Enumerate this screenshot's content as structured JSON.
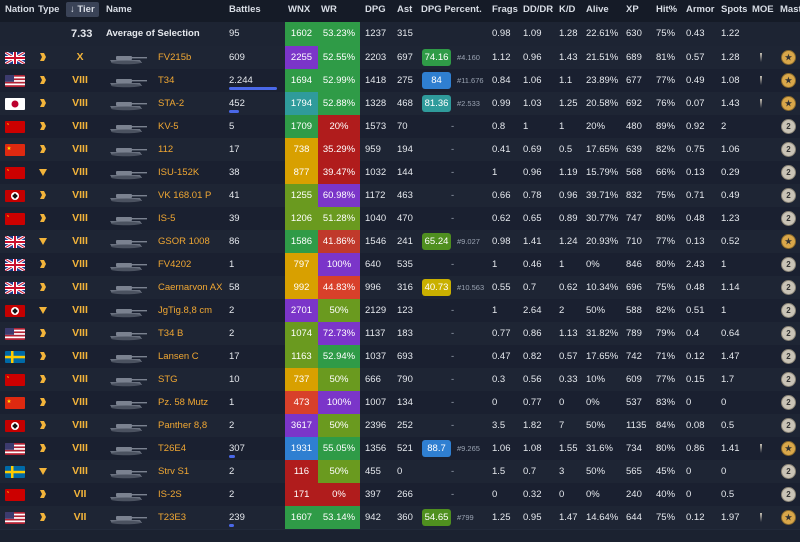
{
  "headers": {
    "nation": "Nation",
    "type": "Type",
    "tier": "↓ Tier",
    "name": "Name",
    "battles": "Battles",
    "wnx": "WNX",
    "wr": "WR",
    "dpg": "DPG",
    "ast": "Ast",
    "dpg_percent": "DPG Percent.",
    "frags": "Frags",
    "dddr": "DD/DR",
    "kd": "K/D",
    "alive": "Alive",
    "xp": "XP",
    "hit": "Hit%",
    "armor": "Armor",
    "spots": "Spots",
    "moe": "MOE",
    "mast": "Mast"
  },
  "average": {
    "tier": "7.33",
    "name": "Average of Selection",
    "battles": "95",
    "wnx": "1602",
    "wr": "53.23%",
    "dpg": "1237",
    "ast": "315",
    "frags": "0.98",
    "dddr": "1.09",
    "kd": "1.28",
    "alive": "22.61%",
    "xp": "630",
    "hit": "75%",
    "armor": "0.43",
    "spots": "1.22",
    "wnx_color": "#2f9b47",
    "wr_color": "#2f9b47"
  },
  "rows": [
    {
      "nation": "uk",
      "type": "td",
      "tier": "X",
      "name": "FV215b",
      "battles": "609",
      "bar": 0,
      "wnx": "2255",
      "wnx_color": "#7b35c9",
      "wr": "52.55%",
      "wr_color": "#2f9b47",
      "dpg": "2203",
      "ast": "697",
      "dpgp": "74.16",
      "dpgp_color": "#2f9b47",
      "rank": "#4.160",
      "frags": "1.12",
      "dddr": "0.96",
      "kd": "1.43",
      "alive": "21.51%",
      "xp": "689",
      "hit": "81%",
      "armor": "0.57",
      "spots": "1.28",
      "moe": true,
      "mast": "gold"
    },
    {
      "nation": "us",
      "type": "td",
      "tier": "VIII",
      "name": "T34",
      "battles": "2.244",
      "bar": 48,
      "wnx": "1694",
      "wnx_color": "#2f9b47",
      "wr": "52.99%",
      "wr_color": "#2f9b47",
      "dpg": "1418",
      "ast": "275",
      "dpgp": "84",
      "dpgp_color": "#2f7fd1",
      "rank": "#11.676",
      "frags": "0.84",
      "dddr": "1.06",
      "kd": "1.1",
      "alive": "23.89%",
      "xp": "677",
      "hit": "77%",
      "armor": "0.49",
      "spots": "1.08",
      "moe": true,
      "mast": "gold"
    },
    {
      "nation": "jp",
      "type": "td",
      "tier": "VIII",
      "name": "STA-2",
      "battles": "452",
      "bar": 10,
      "wnx": "1794",
      "wnx_color": "#2f9b9b",
      "wr": "52.88%",
      "wr_color": "#2f9b47",
      "dpg": "1328",
      "ast": "468",
      "dpgp": "81.36",
      "dpgp_color": "#2f9b9b",
      "rank": "#2.533",
      "frags": "0.99",
      "dddr": "1.03",
      "kd": "1.25",
      "alive": "20.58%",
      "xp": "692",
      "hit": "76%",
      "armor": "0.07",
      "spots": "1.43",
      "moe": true,
      "mast": "gold"
    },
    {
      "nation": "ussr",
      "type": "td",
      "tier": "VIII",
      "name": "KV-5",
      "battles": "5",
      "bar": 0,
      "wnx": "1709",
      "wnx_color": "#2f9b47",
      "wr": "20%",
      "wr_color": "#b01c1c",
      "dpg": "1573",
      "ast": "70",
      "dpgp": "",
      "dpgp_color": "",
      "rank": "",
      "frags": "0.8",
      "dddr": "1",
      "kd": "1",
      "alive": "20%",
      "xp": "480",
      "hit": "89%",
      "armor": "0.92",
      "spots": "2",
      "moe": false,
      "mast": "silver"
    },
    {
      "nation": "china",
      "type": "td",
      "tier": "VIII",
      "name": "112",
      "battles": "17",
      "bar": 0,
      "wnx": "738",
      "wnx_color": "#d8a000",
      "wr": "35.29%",
      "wr_color": "#b01c1c",
      "dpg": "959",
      "ast": "194",
      "dpgp": "",
      "dpgp_color": "",
      "rank": "",
      "frags": "0.41",
      "dddr": "0.69",
      "kd": "0.5",
      "alive": "17.65%",
      "xp": "639",
      "hit": "82%",
      "armor": "0.75",
      "spots": "1.06",
      "moe": false,
      "mast": "silver"
    },
    {
      "nation": "ussr",
      "type": "spg",
      "tier": "VIII",
      "name": "ISU-152K",
      "battles": "38",
      "bar": 0,
      "wnx": "877",
      "wnx_color": "#d8a000",
      "wr": "39.47%",
      "wr_color": "#b01c1c",
      "dpg": "1032",
      "ast": "144",
      "dpgp": "",
      "dpgp_color": "",
      "rank": "",
      "frags": "1",
      "dddr": "0.96",
      "kd": "1.19",
      "alive": "15.79%",
      "xp": "568",
      "hit": "66%",
      "armor": "0.13",
      "spots": "0.29",
      "moe": false,
      "mast": "silver"
    },
    {
      "nation": "de",
      "type": "td",
      "tier": "VIII",
      "name": "VK 168.01 P",
      "battles": "41",
      "bar": 0,
      "wnx": "1255",
      "wnx_color": "#6a9a1f",
      "wr": "60.98%",
      "wr_color": "#7b35c9",
      "dpg": "1172",
      "ast": "463",
      "dpgp": "",
      "dpgp_color": "",
      "rank": "",
      "frags": "0.66",
      "dddr": "0.78",
      "kd": "0.96",
      "alive": "39.71%",
      "xp": "832",
      "hit": "75%",
      "armor": "0.71",
      "spots": "0.49",
      "moe": false,
      "mast": "silver"
    },
    {
      "nation": "ussr",
      "type": "td",
      "tier": "VIII",
      "name": "IS-5",
      "battles": "39",
      "bar": 0,
      "wnx": "1206",
      "wnx_color": "#6a9a1f",
      "wr": "51.28%",
      "wr_color": "#6a9a1f",
      "dpg": "1040",
      "ast": "470",
      "dpgp": "",
      "dpgp_color": "",
      "rank": "",
      "frags": "0.62",
      "dddr": "0.65",
      "kd": "0.89",
      "alive": "30.77%",
      "xp": "747",
      "hit": "80%",
      "armor": "0.48",
      "spots": "1.23",
      "moe": false,
      "mast": "silver"
    },
    {
      "nation": "uk",
      "type": "spg",
      "tier": "VIII",
      "name": "GSOR 1008",
      "battles": "86",
      "bar": 0,
      "wnx": "1586",
      "wnx_color": "#2f9b47",
      "wr": "41.86%",
      "wr_color": "#c0392b",
      "dpg": "1546",
      "ast": "241",
      "dpgp": "65.24",
      "dpgp_color": "#4f8f1f",
      "rank": "#9.027",
      "frags": "0.98",
      "dddr": "1.41",
      "kd": "1.24",
      "alive": "20.93%",
      "xp": "710",
      "hit": "77%",
      "armor": "0.13",
      "spots": "0.52",
      "moe": false,
      "mast": "gold"
    },
    {
      "nation": "uk",
      "type": "td",
      "tier": "VIII",
      "name": "FV4202",
      "battles": "1",
      "bar": 0,
      "wnx": "797",
      "wnx_color": "#d8a000",
      "wr": "100%",
      "wr_color": "#7b35c9",
      "dpg": "640",
      "ast": "535",
      "dpgp": "",
      "dpgp_color": "",
      "rank": "",
      "frags": "1",
      "dddr": "0.46",
      "kd": "1",
      "alive": "0%",
      "xp": "846",
      "hit": "80%",
      "armor": "2.43",
      "spots": "1",
      "moe": false,
      "mast": "silver"
    },
    {
      "nation": "uk",
      "type": "td",
      "tier": "VIII",
      "name": "Caernarvon AX",
      "battles": "58",
      "bar": 0,
      "wnx": "992",
      "wnx_color": "#d8a000",
      "wr": "44.83%",
      "wr_color": "#d8402a",
      "dpg": "996",
      "ast": "316",
      "dpgp": "40.73",
      "dpgp_color": "#c9b000",
      "rank": "#10.563",
      "frags": "0.55",
      "dddr": "0.7",
      "kd": "0.62",
      "alive": "10.34%",
      "xp": "696",
      "hit": "75%",
      "armor": "0.48",
      "spots": "1.14",
      "moe": false,
      "mast": "silver"
    },
    {
      "nation": "de",
      "type": "spg",
      "tier": "VIII",
      "name": "JgTig.8,8 cm",
      "battles": "2",
      "bar": 0,
      "wnx": "2701",
      "wnx_color": "#7b35c9",
      "wr": "50%",
      "wr_color": "#6a9a1f",
      "dpg": "2129",
      "ast": "123",
      "dpgp": "",
      "dpgp_color": "",
      "rank": "",
      "frags": "1",
      "dddr": "2.64",
      "kd": "2",
      "alive": "50%",
      "xp": "588",
      "hit": "82%",
      "armor": "0.51",
      "spots": "1",
      "moe": false,
      "mast": "silver"
    },
    {
      "nation": "us",
      "type": "td",
      "tier": "VIII",
      "name": "T34 B",
      "battles": "2",
      "bar": 0,
      "wnx": "1074",
      "wnx_color": "#6a9a1f",
      "wr": "72.73%",
      "wr_color": "#7b35c9",
      "dpg": "1137",
      "ast": "183",
      "dpgp": "",
      "dpgp_color": "",
      "rank": "",
      "frags": "0.77",
      "dddr": "0.86",
      "kd": "1.13",
      "alive": "31.82%",
      "xp": "789",
      "hit": "79%",
      "armor": "0.4",
      "spots": "0.64",
      "moe": false,
      "mast": "silver"
    },
    {
      "nation": "se",
      "type": "td",
      "tier": "VIII",
      "name": "Lansen C",
      "battles": "17",
      "bar": 0,
      "wnx": "1163",
      "wnx_color": "#6a9a1f",
      "wr": "52.94%",
      "wr_color": "#2f9b47",
      "dpg": "1037",
      "ast": "693",
      "dpgp": "",
      "dpgp_color": "",
      "rank": "",
      "frags": "0.47",
      "dddr": "0.82",
      "kd": "0.57",
      "alive": "17.65%",
      "xp": "742",
      "hit": "71%",
      "armor": "0.12",
      "spots": "1.47",
      "moe": false,
      "mast": "silver"
    },
    {
      "nation": "ussr",
      "type": "td",
      "tier": "VIII",
      "name": "STG",
      "battles": "10",
      "bar": 0,
      "wnx": "737",
      "wnx_color": "#d8a000",
      "wr": "50%",
      "wr_color": "#6a9a1f",
      "dpg": "666",
      "ast": "790",
      "dpgp": "",
      "dpgp_color": "",
      "rank": "",
      "frags": "0.3",
      "dddr": "0.56",
      "kd": "0.33",
      "alive": "10%",
      "xp": "609",
      "hit": "77%",
      "armor": "0.15",
      "spots": "1.7",
      "moe": false,
      "mast": "silver"
    },
    {
      "nation": "china",
      "type": "td",
      "tier": "VIII",
      "name": "Pz. 58 Mutz",
      "battles": "1",
      "bar": 0,
      "wnx": "473",
      "wnx_color": "#d8402a",
      "wr": "100%",
      "wr_color": "#7b35c9",
      "dpg": "1007",
      "ast": "134",
      "dpgp": "",
      "dpgp_color": "",
      "rank": "",
      "frags": "0",
      "dddr": "0.77",
      "kd": "0",
      "alive": "0%",
      "xp": "537",
      "hit": "83%",
      "armor": "0",
      "spots": "0",
      "moe": false,
      "mast": "silver"
    },
    {
      "nation": "de",
      "type": "td",
      "tier": "VIII",
      "name": "Panther 8,8",
      "battles": "2",
      "bar": 0,
      "wnx": "3617",
      "wnx_color": "#7b35c9",
      "wr": "50%",
      "wr_color": "#6a9a1f",
      "dpg": "2396",
      "ast": "252",
      "dpgp": "",
      "dpgp_color": "",
      "rank": "",
      "frags": "3.5",
      "dddr": "1.82",
      "kd": "7",
      "alive": "50%",
      "xp": "1135",
      "hit": "84%",
      "armor": "0.08",
      "spots": "0.5",
      "moe": false,
      "mast": "silver"
    },
    {
      "nation": "us",
      "type": "td",
      "tier": "VIII",
      "name": "T26E4",
      "battles": "307",
      "bar": 6,
      "wnx": "1931",
      "wnx_color": "#2f7fd1",
      "wr": "55.05%",
      "wr_color": "#2f9b47",
      "dpg": "1356",
      "ast": "521",
      "dpgp": "88.7",
      "dpgp_color": "#2f7fd1",
      "rank": "#9.265",
      "frags": "1.06",
      "dddr": "1.08",
      "kd": "1.55",
      "alive": "31.6%",
      "xp": "734",
      "hit": "80%",
      "armor": "0.86",
      "spots": "1.41",
      "moe": true,
      "mast": "gold"
    },
    {
      "nation": "se",
      "type": "spg",
      "tier": "VIII",
      "name": "Strv S1",
      "battles": "2",
      "bar": 0,
      "wnx": "116",
      "wnx_color": "#b01c1c",
      "wr": "50%",
      "wr_color": "#6a9a1f",
      "dpg": "455",
      "ast": "0",
      "dpgp": "",
      "dpgp_color": "",
      "rank": "",
      "frags": "1.5",
      "dddr": "0.7",
      "kd": "3",
      "alive": "50%",
      "xp": "565",
      "hit": "45%",
      "armor": "0",
      "spots": "0",
      "moe": false,
      "mast": "silver"
    },
    {
      "nation": "ussr",
      "type": "td",
      "tier": "VII",
      "name": "IS-2S",
      "battles": "2",
      "bar": 0,
      "wnx": "171",
      "wnx_color": "#b01c1c",
      "wr": "0%",
      "wr_color": "#b01c1c",
      "dpg": "397",
      "ast": "266",
      "dpgp": "",
      "dpgp_color": "",
      "rank": "",
      "frags": "0",
      "dddr": "0.32",
      "kd": "0",
      "alive": "0%",
      "xp": "240",
      "hit": "40%",
      "armor": "0",
      "spots": "0.5",
      "moe": false,
      "mast": "silver"
    },
    {
      "nation": "us",
      "type": "td",
      "tier": "VII",
      "name": "T23E3",
      "battles": "239",
      "bar": 5,
      "wnx": "1607",
      "wnx_color": "#2f9b47",
      "wr": "53.14%",
      "wr_color": "#2f9b47",
      "dpg": "942",
      "ast": "360",
      "dpgp": "54.65",
      "dpgp_color": "#4f8f1f",
      "rank": "#799",
      "frags": "1.25",
      "dddr": "0.95",
      "kd": "1.47",
      "alive": "14.64%",
      "xp": "644",
      "hit": "75%",
      "armor": "0.12",
      "spots": "1.97",
      "moe": true,
      "mast": "gold"
    }
  ]
}
